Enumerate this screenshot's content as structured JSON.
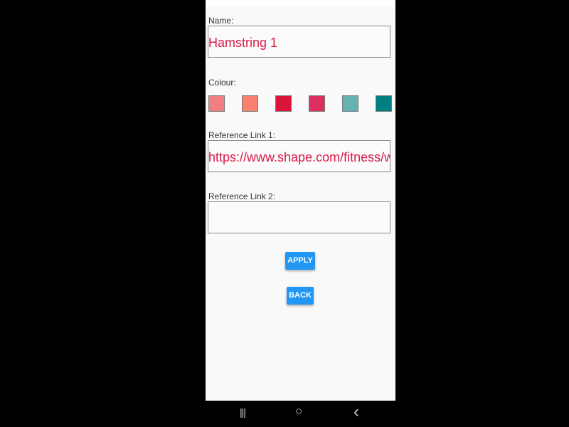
{
  "form": {
    "name_label": "Name:",
    "name_value": "Hamstring 1",
    "colour_label": "Colour:",
    "colours": [
      "#F08080",
      "#FA8072",
      "#DC143C",
      "#DC3060",
      "#66B2B2",
      "#008080"
    ],
    "ref1_label": "Reference Link 1:",
    "ref1_value": "https://www.shape.com/fitness/workouts",
    "ref2_label": "Reference Link 2:",
    "ref2_value": ""
  },
  "buttons": {
    "apply": "APPLY",
    "back": "BACK"
  },
  "nav": {
    "recents": "|||",
    "home": "○",
    "back": "‹"
  }
}
